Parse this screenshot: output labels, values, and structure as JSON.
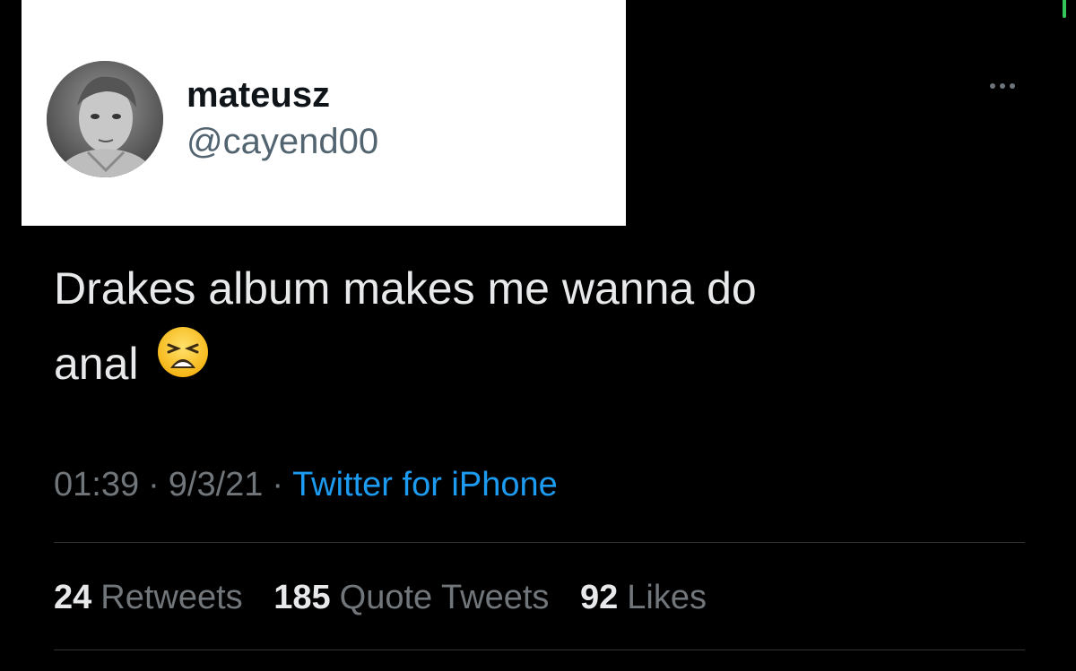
{
  "author": {
    "display_name": "mateusz",
    "handle": "@cayend00"
  },
  "tweet": {
    "text_line1": "Drakes album makes me wanna do",
    "text_line2": "anal",
    "emoji": "weary-face"
  },
  "meta": {
    "time": "01:39",
    "date": "9/3/21",
    "separator": "·",
    "source": "Twitter for iPhone"
  },
  "stats": {
    "retweets_count": "24",
    "retweets_label": "Retweets",
    "quotes_count": "185",
    "quotes_label": "Quote Tweets",
    "likes_count": "92",
    "likes_label": "Likes"
  },
  "colors": {
    "background": "#000000",
    "text": "#e7e9ea",
    "muted": "#71767b",
    "accent": "#1d9bf0",
    "header_card": "#ffffff"
  },
  "icons": {
    "more": "more-options-icon",
    "avatar": "avatar-photo"
  }
}
